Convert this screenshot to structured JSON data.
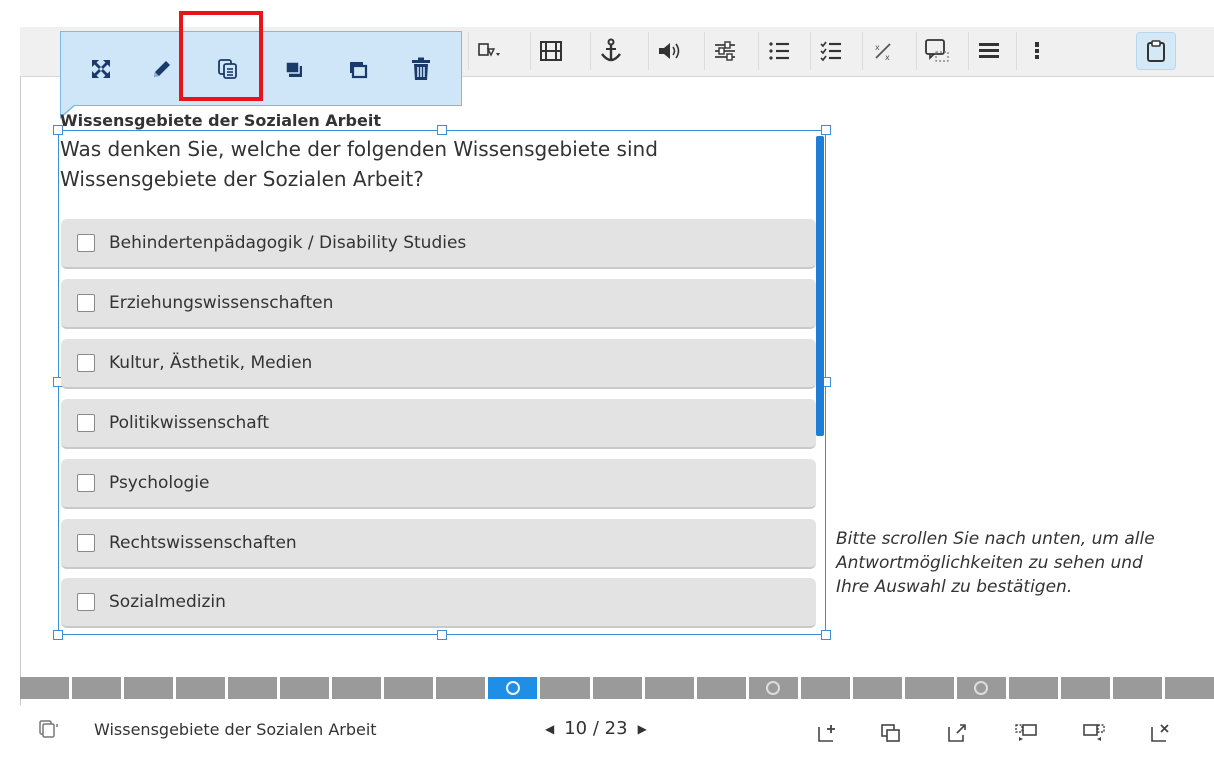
{
  "toolbar": {
    "buttons": [
      "shapes-dropdown",
      "video",
      "anchor",
      "audio",
      "sliders",
      "numbered-list",
      "checklist",
      "fraction",
      "screen-capture",
      "list",
      "more",
      "clipboard"
    ]
  },
  "context_toolbar": {
    "buttons": [
      "fullscreen",
      "edit",
      "duplicate",
      "bring-to-front",
      "send-to-back",
      "delete"
    ]
  },
  "content": {
    "title": "Wissensgebiete der Sozialen Arbeit",
    "question": "Was denken Sie, welche der folgenden Wissensgebiete sind Wissensgebiete der Sozialen Arbeit?",
    "options": [
      "Behindertenpädagogik / Disability Studies",
      "Erziehungswissenschaften",
      "Kultur, Ästhetik, Medien",
      "Politikwissenschaft",
      "Psychologie",
      "Rechtswissenschaften",
      "Sozialmedizin"
    ],
    "hint": "Bitte scrollen Sie nach unten, um alle Antwortmöglichkeiten zu sehen und Ihre Auswahl zu bestätigen."
  },
  "footer": {
    "slide_title": "Wissensgebiete der Sozialen Arbeit",
    "page_label": "10 / 23",
    "prev_arrow": "◀",
    "next_arrow": "▶"
  },
  "colors": {
    "selection": "#3a8fd8",
    "context_bg": "#cfe6f8",
    "highlight": "#e8141c",
    "progress_current": "#1f8fe5",
    "progress": "#9a9a9a"
  }
}
